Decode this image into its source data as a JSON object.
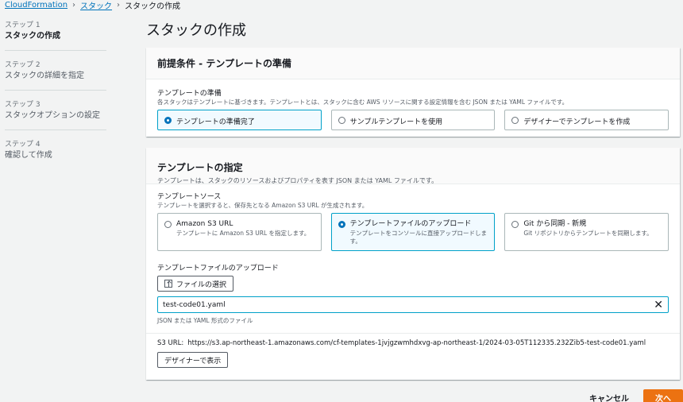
{
  "breadcrumb": {
    "root": "CloudFormation",
    "parent": "スタック",
    "current": "スタックの作成"
  },
  "steps": [
    {
      "num": "ステップ 1",
      "title": "スタックの作成"
    },
    {
      "num": "ステップ 2",
      "title": "スタックの詳細を指定"
    },
    {
      "num": "ステップ 3",
      "title": "スタックオプションの設定"
    },
    {
      "num": "ステップ 4",
      "title": "確認して作成"
    }
  ],
  "page_title": "スタックの作成",
  "prereq": {
    "title": "前提条件 - テンプレートの準備",
    "label": "テンプレートの準備",
    "desc": "各スタックはテンプレートに基づきます。テンプレートとは、スタックに含む AWS リソースに関する設定情報を含む JSON または YAML ファイルです。",
    "options": [
      {
        "label": "テンプレートの準備完了",
        "selected": true
      },
      {
        "label": "サンプルテンプレートを使用",
        "selected": false
      },
      {
        "label": "デザイナーでテンプレートを作成",
        "selected": false
      }
    ]
  },
  "spec": {
    "title": "テンプレートの指定",
    "desc": "テンプレートは、スタックのリソースおよびプロパティを表す JSON または YAML ファイルです。",
    "source_label": "テンプレートソース",
    "source_desc": "テンプレートを選択すると、保存先となる Amazon S3 URL が生成されます。",
    "sources": [
      {
        "label": "Amazon S3 URL",
        "sub": "テンプレートに Amazon S3 URL を指定します。",
        "selected": false
      },
      {
        "label": "テンプレートファイルのアップロード",
        "sub": "テンプレートをコンソールに直接アップロードします。",
        "selected": true
      },
      {
        "label": "Git から同期 - 新規",
        "sub": "Git リポジトリからテンプレートを同期します。",
        "selected": false
      }
    ],
    "upload_label": "テンプレートファイルのアップロード",
    "choose_file": "ファイルの選択",
    "file_value": "test-code01.yaml",
    "file_hint": "JSON または YAML 形式のファイル",
    "s3_label": "S3 URL:",
    "s3_value": "https://s3.ap-northeast-1.amazonaws.com/cf-templates-1jvjgzwmhdxvg-ap-northeast-1/2024-03-05T112335.232Zib5-test-code01.yaml",
    "designer_button": "デザイナーで表示"
  },
  "footer": {
    "cancel": "キャンセル",
    "next": "次へ"
  },
  "colors": {
    "accent": "#0073bb",
    "primary_button": "#ec7211",
    "selected_border": "#00a1c9"
  }
}
